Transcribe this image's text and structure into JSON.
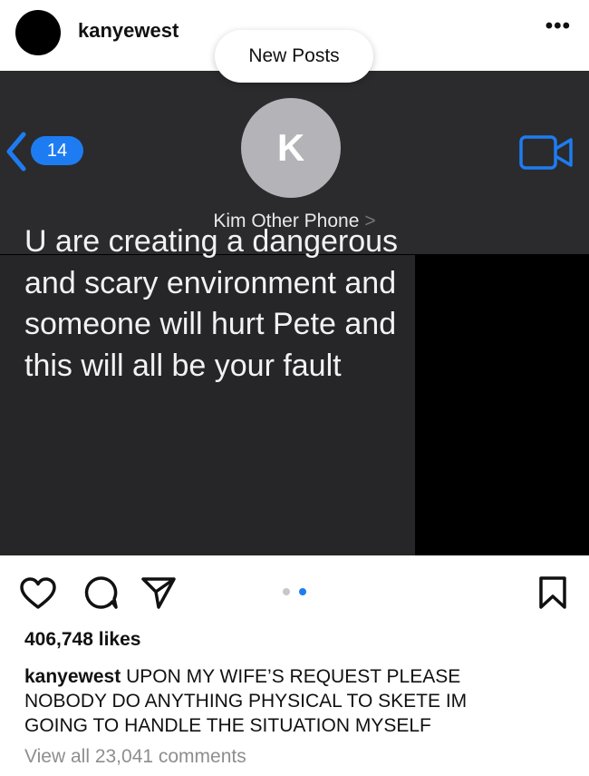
{
  "post": {
    "username": "kanyewest",
    "more_icon": "•••",
    "new_posts_label": "New Posts"
  },
  "screenshot": {
    "unread_count": "14",
    "contact_initial": "K",
    "contact_name": "Kim Other Phone",
    "contact_chevron": ">",
    "message_text": "U are creating a dangerous and scary environment and someone will hurt Pete and this will all be your fault"
  },
  "actions": {
    "icons": [
      "heart-icon",
      "comment-icon",
      "share-icon",
      "bookmark-icon"
    ],
    "carousel": {
      "count": 2,
      "active": 1,
      "active_color": "#1e7cf2",
      "inactive_color": "#c7c7c7"
    }
  },
  "likes": "406,748 likes",
  "caption": {
    "username": "kanyewest",
    "text": "UPON MY WIFE’S REQUEST PLEASE NOBODY DO ANYTHING PHYSICAL TO SKETE  IM GOING TO HANDLE THE SITUATION MYSELF"
  },
  "comments_link": "View all 23,041 comments",
  "colors": {
    "accent": "#1e7cf2",
    "dark_header": "#2b2b2d",
    "bubble": "#262628"
  }
}
